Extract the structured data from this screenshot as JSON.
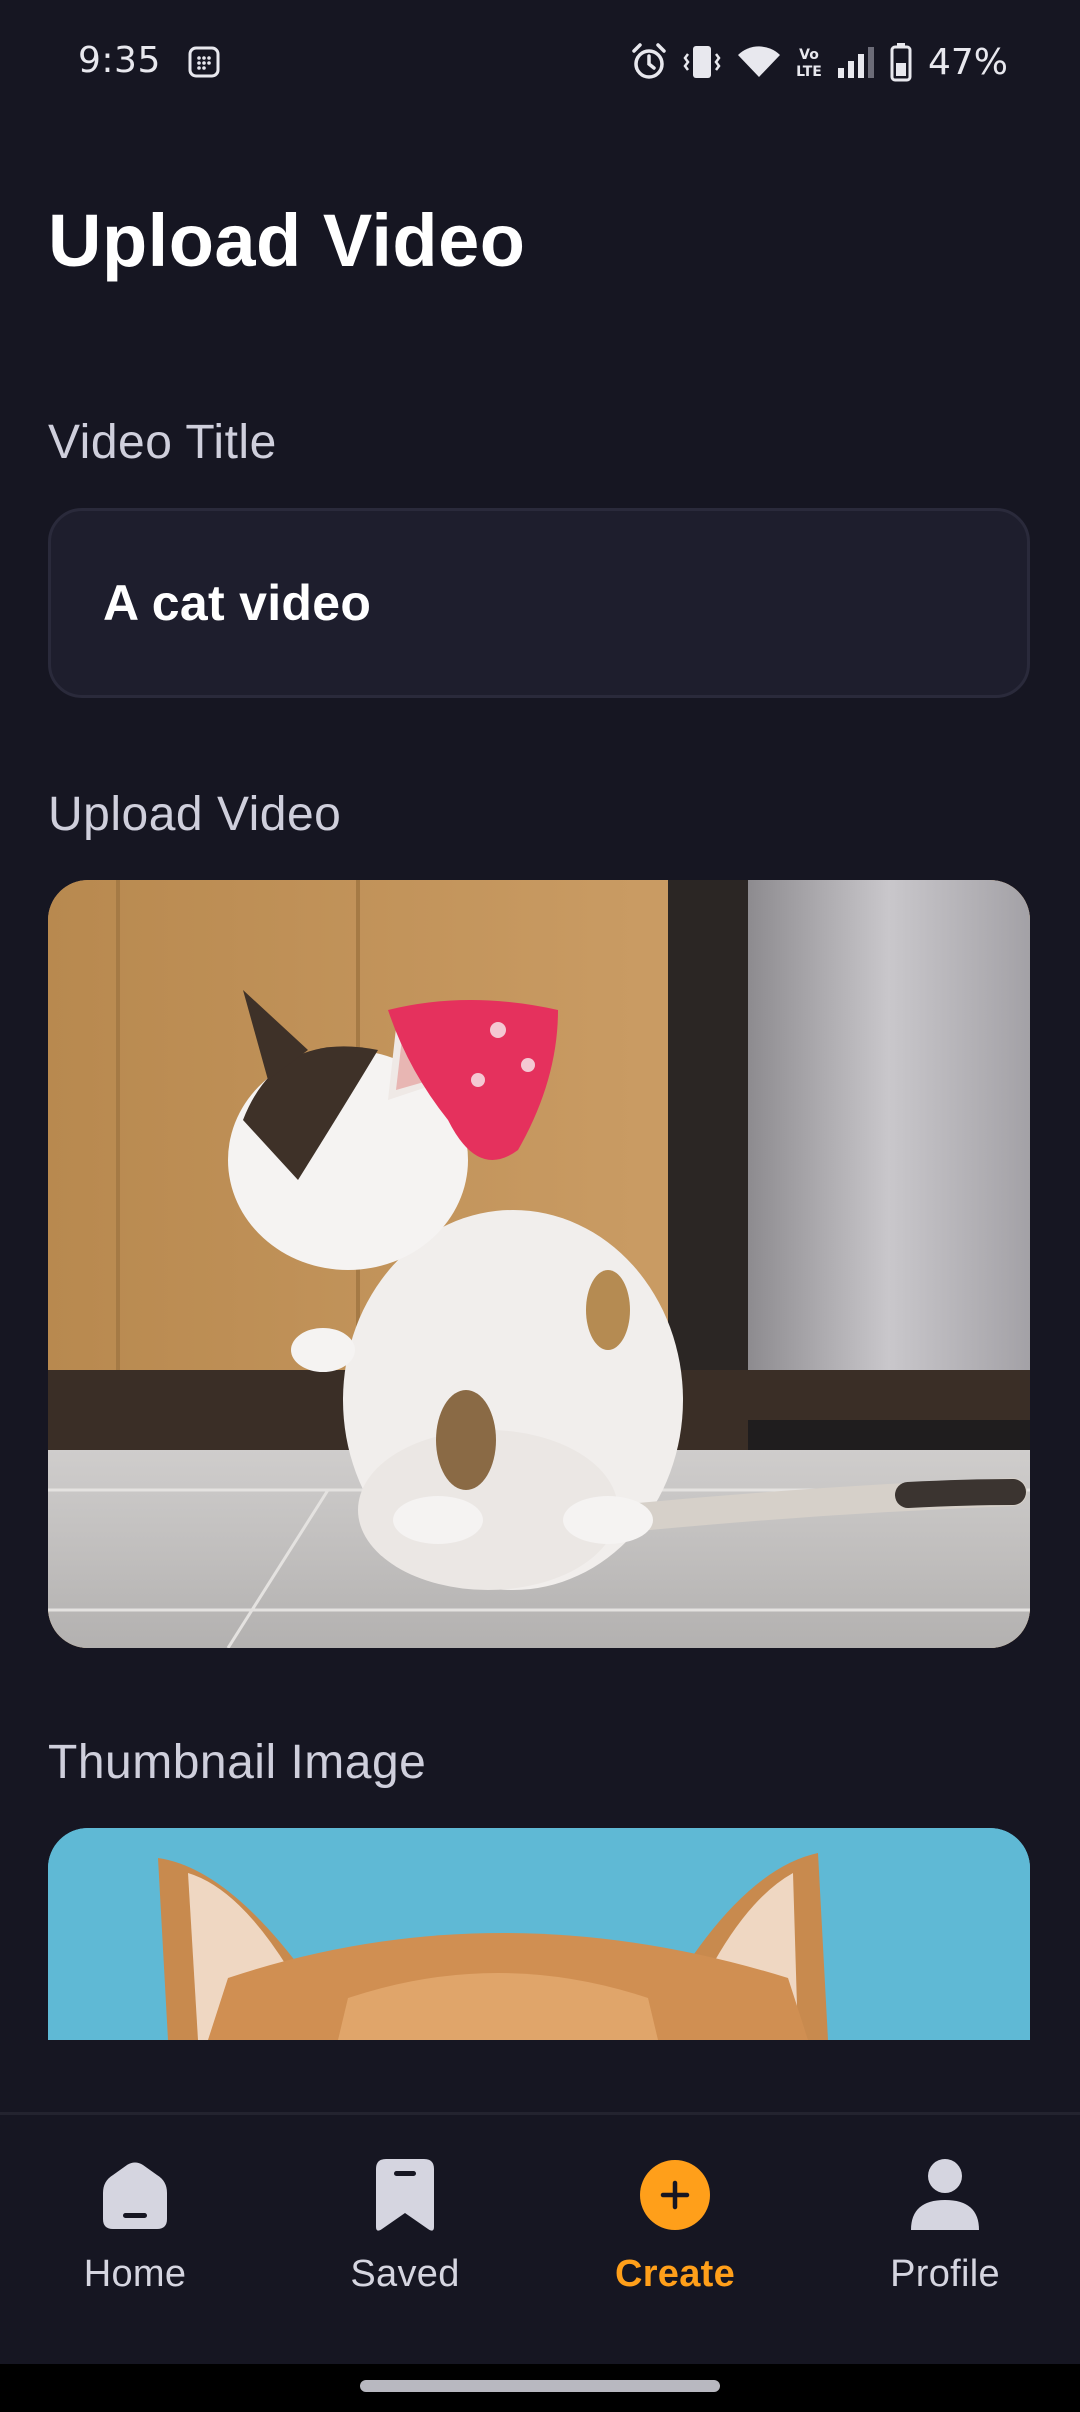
{
  "status_bar": {
    "time": "9:35",
    "battery": "47%",
    "icons": [
      "calendar-icon",
      "alarm-icon",
      "vibrate-icon",
      "wifi-icon",
      "volte-icon",
      "signal-icon",
      "battery-icon"
    ]
  },
  "page": {
    "title": "Upload Video"
  },
  "form": {
    "title_label": "Video Title",
    "title_value": "A cat video",
    "video_label": "Upload Video",
    "thumbnail_label": "Thumbnail Image"
  },
  "nav": {
    "items": [
      {
        "label": "Home",
        "icon": "home-icon"
      },
      {
        "label": "Saved",
        "icon": "bookmark-icon"
      },
      {
        "label": "Create",
        "icon": "plus-circle-icon",
        "active": true
      },
      {
        "label": "Profile",
        "icon": "profile-icon"
      }
    ]
  },
  "colors": {
    "background": "#161622",
    "input_background": "#1e1e2d",
    "accent": "#ff9f1a",
    "label": "#cfcfdc"
  }
}
